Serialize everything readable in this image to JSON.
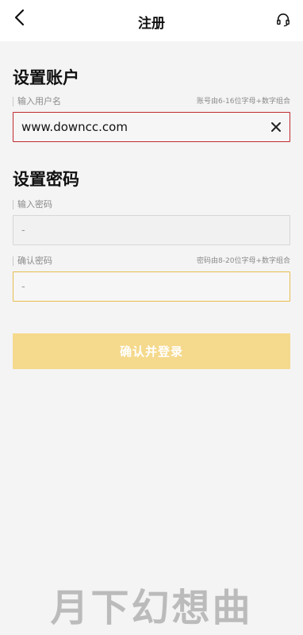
{
  "header": {
    "title": "注册",
    "back_icon": "chevron-left-icon",
    "support_icon": "headset-icon"
  },
  "account_section": {
    "title": "设置账户",
    "username": {
      "label": "输入用户名",
      "hint": "账号由6-16位字母+数字组合",
      "value": "www.downcc.com",
      "state": "error",
      "clear_icon": "close-icon"
    }
  },
  "password_section": {
    "title": "设置密码",
    "password": {
      "label": "输入密码",
      "placeholder": "-"
    },
    "confirm": {
      "label": "确认密码",
      "hint": "密码由8-20位字母+数字组合",
      "placeholder": "-",
      "state": "focused"
    }
  },
  "submit": {
    "label": "确认并登录",
    "state": "disabled"
  },
  "watermark": "月下幻想曲",
  "colors": {
    "background": "#f4f4f4",
    "error_border": "#c0292f",
    "focus_border": "#e6bd4f",
    "button_disabled": "#f5d98c"
  }
}
